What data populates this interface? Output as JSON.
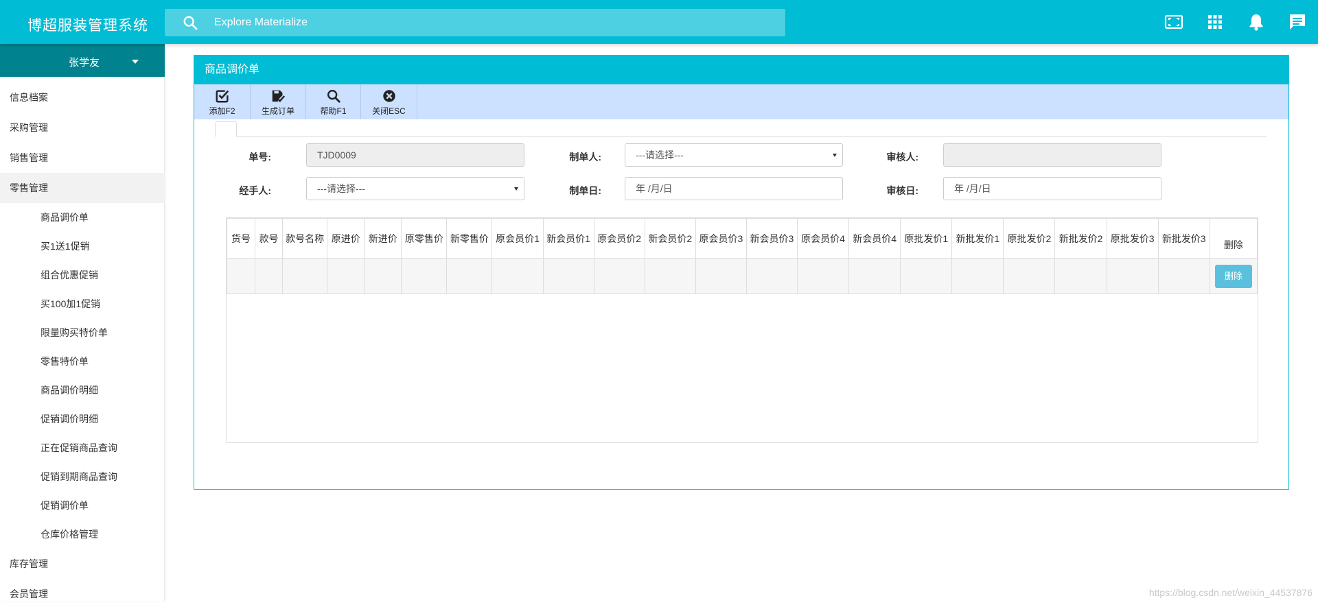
{
  "header": {
    "brand": "博超服装管理系统",
    "search_placeholder": "Explore Materialize"
  },
  "sidebar": {
    "user": "张学友",
    "menu": [
      {
        "label": "信息档案"
      },
      {
        "label": "采购管理"
      },
      {
        "label": "销售管理"
      },
      {
        "label": "零售管理",
        "active": true
      }
    ],
    "submenu": [
      "商品调价单",
      "买1送1促销",
      "组合优惠促销",
      "买100加1促销",
      "限量购买特价单",
      "零售特价单",
      "商品调价明细",
      "促销调价明细",
      "正在促销商品查询",
      "促销到期商品查询",
      "促销调价单",
      "仓库价格管理"
    ],
    "menu_after": [
      {
        "label": "库存管理"
      },
      {
        "label": "会员管理"
      }
    ]
  },
  "panel": {
    "title": "商品调价单",
    "toolbar": [
      {
        "label": "添加F2",
        "icon": "checkbox-icon"
      },
      {
        "label": "生成订单",
        "icon": "save-check-icon"
      },
      {
        "label": "帮助F1",
        "icon": "search-icon"
      },
      {
        "label": "关闭ESC",
        "icon": "close-circle-icon"
      }
    ]
  },
  "form": {
    "order_no_label": "单号:",
    "order_no_value": "TJD0009",
    "creator_label": "制单人:",
    "creator_value": "---请选择---",
    "reviewer_label": "审核人:",
    "reviewer_value": "",
    "handler_label": "经手人:",
    "handler_value": "---请选择---",
    "create_date_label": "制单日:",
    "create_date_value": "年 /月/日",
    "review_date_label": "审核日:",
    "review_date_value": "年 /月/日"
  },
  "table": {
    "columns": [
      "货号",
      "款号",
      "款号名称",
      "原进价",
      "新进价",
      "原零售价",
      "新零售价",
      "原会员价1",
      "新会员价1",
      "原会员价2",
      "新会员价2",
      "原会员价3",
      "新会员价3",
      "原会员价4",
      "新会员价4",
      "原批发价1",
      "新批发价1",
      "原批发价2",
      "新批发价2",
      "原批发价3",
      "新批发价3",
      "删除"
    ],
    "delete_button": "删除"
  },
  "watermark": "https://blog.csdn.net/weixin_44537876",
  "colors": {
    "primary": "#00bcd4",
    "primary_dark": "#00838f",
    "search_bg": "#4dd0e1",
    "toolbar_bg": "#cce0ff",
    "delete_button": "#5bc0de"
  }
}
